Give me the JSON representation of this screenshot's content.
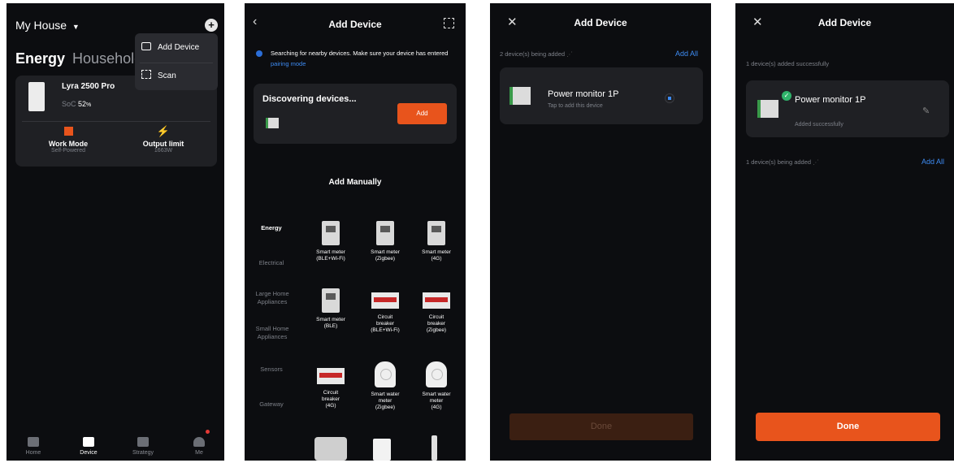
{
  "panel1": {
    "house_title": "My House",
    "tabs": [
      "Energy",
      "Household"
    ],
    "menu": {
      "add_device": "Add Device",
      "scan": "Scan"
    },
    "device": {
      "name": "Lyra 2500 Pro",
      "soc_label": "SoC",
      "soc_value": "52",
      "soc_unit": "%"
    },
    "work_mode": {
      "label": "Work Mode",
      "value": "Self-Powered"
    },
    "output_limit": {
      "label": "Output limit",
      "value": "1663W"
    },
    "nav": [
      "Home",
      "Device",
      "Strategy",
      "Me"
    ]
  },
  "panel2": {
    "title": "Add Device",
    "search_text": "Searching for nearby devices. Make sure your device has entered",
    "pairing_link": "pairing mode",
    "discovering": "Discovering devices...",
    "add_btn": "Add",
    "manual_title": "Add Manually",
    "categories": [
      "Energy",
      "Electrical",
      "Large Home Appliances",
      "Small Home Appliances",
      "Sensors",
      "Gateway"
    ],
    "devices": [
      {
        "line1": "Smart meter",
        "line2": "(BLE+Wi-Fi)",
        "line3": ""
      },
      {
        "line1": "Smart meter",
        "line2": "(Zigbee)",
        "line3": ""
      },
      {
        "line1": "Smart meter",
        "line2": "(4G)",
        "line3": ""
      },
      {
        "line1": "Smart meter",
        "line2": "(BLE)",
        "line3": ""
      },
      {
        "line1": "Circuit",
        "line2": "breaker",
        "line3": "(BLE+Wi-Fi)"
      },
      {
        "line1": "Circuit",
        "line2": "breaker",
        "line3": "(Zigbee)"
      },
      {
        "line1": "Circuit",
        "line2": "breaker",
        "line3": "(4G)"
      },
      {
        "line1": "Smart water",
        "line2": "meter",
        "line3": "(Zigbee)"
      },
      {
        "line1": "Smart water",
        "line2": "meter",
        "line3": "(4G)"
      }
    ]
  },
  "panel3": {
    "title": "Add Device",
    "being_added": "2 device(s) being added",
    "add_all": "Add All",
    "device_name": "Power monitor 1P",
    "device_sub": "Tap to add this device",
    "done": "Done"
  },
  "panel4": {
    "title": "Add Device",
    "added_success_header": "1 device(s) added successfully",
    "device_name": "Power monitor 1P",
    "device_status": "Added successfully",
    "being_added": "1 device(s) being added",
    "add_all": "Add All",
    "done": "Done"
  },
  "colors": {
    "accent": "#e8541c",
    "link": "#3d8bf2",
    "success": "#2fb36a"
  }
}
